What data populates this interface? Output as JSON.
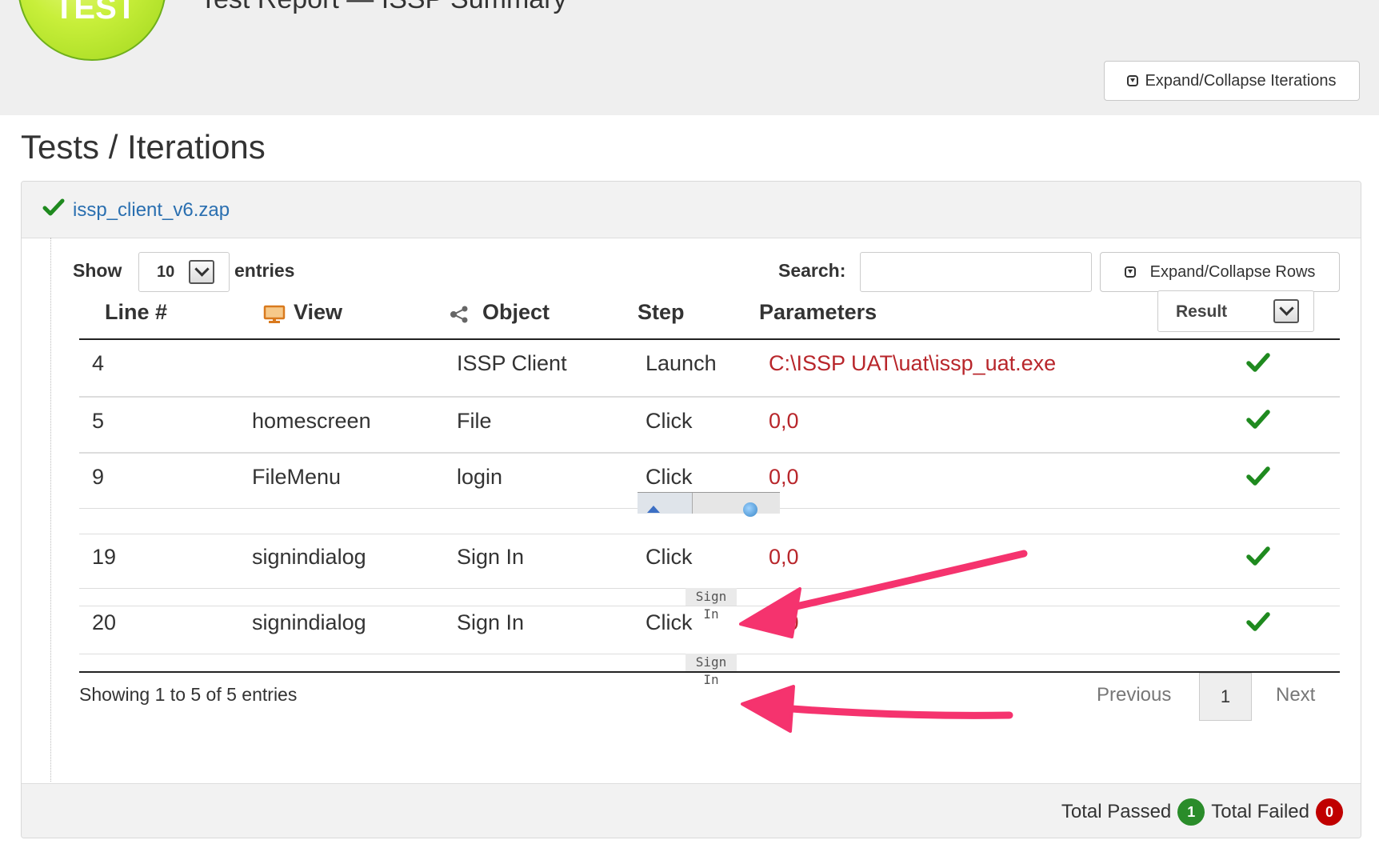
{
  "header": {
    "logo_text": "TEST",
    "subtitle": "Test Report — ISSP Summary",
    "expand_iterations_label": "Expand/Collapse Iterations"
  },
  "page": {
    "title": "Tests / Iterations"
  },
  "panel": {
    "file_name": "issp_client_v6.zap",
    "controls": {
      "show_label": "Show",
      "entries_value": "10",
      "entries_label": "entries",
      "search_label": "Search:",
      "search_value": "",
      "expand_rows_label": "Expand/Collapse Rows"
    },
    "table": {
      "columns": [
        "Line #",
        "View",
        "Object",
        "Step",
        "Parameters"
      ],
      "result_filter": "Result",
      "rows": [
        {
          "line": "4",
          "view": "",
          "object": "ISSP Client",
          "step": "Launch",
          "parameters": "C:\\ISSP UAT\\uat\\issp_uat.exe",
          "result": "pass"
        },
        {
          "line": "5",
          "view": "homescreen",
          "object": "File",
          "step": "Click",
          "parameters": "0,0",
          "result": "pass"
        },
        {
          "line": "9",
          "view": "FileMenu",
          "object": "login",
          "step": "Click",
          "parameters": "0,0",
          "result": "pass"
        },
        {
          "line": "19",
          "view": "signindialog",
          "object": "Sign In",
          "step": "Click",
          "parameters": "0,0",
          "result": "pass",
          "snapshot_label": "Sign In"
        },
        {
          "line": "20",
          "view": "signindialog",
          "object": "Sign In",
          "step": "Click",
          "parameters": "0,0",
          "result": "pass",
          "snapshot_label": "Sign In"
        }
      ]
    },
    "pagination": {
      "info": "Showing 1 to 5 of 5 entries",
      "previous": "Previous",
      "current_page": "1",
      "next": "Next"
    },
    "totals": {
      "passed_label": "Total Passed",
      "passed_count": "1",
      "failed_label": "Total Failed",
      "failed_count": "0"
    }
  },
  "colors": {
    "pass_check": "#1f8a1f",
    "param_text": "#b8262b",
    "link": "#2a6fb0",
    "annotation_arrow": "#f5336e",
    "badge_pass": "#2a8c2a",
    "badge_fail": "#c00000"
  },
  "icons": {
    "view_column": "monitor-icon",
    "object_column": "share-icon",
    "result": "checkmark-icon",
    "expand": "collapse-square-icon"
  }
}
